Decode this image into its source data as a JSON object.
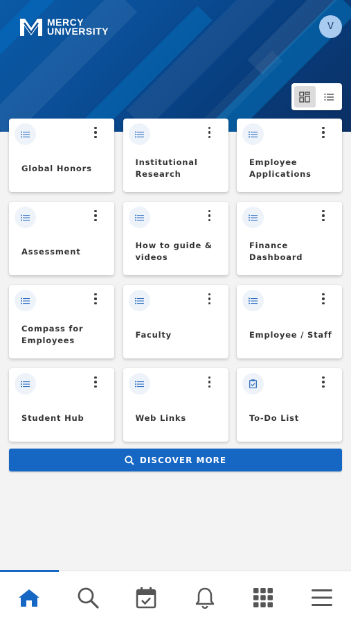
{
  "brand": {
    "line1": "MERCY",
    "line2": "UNIVERSITY"
  },
  "user": {
    "avatar_initial": "V"
  },
  "view_toggle": {
    "active": "grid",
    "options": [
      "grid-view-icon",
      "list-view-icon"
    ]
  },
  "tiles": [
    {
      "label": "Global Honors",
      "icon": "list-icon"
    },
    {
      "label": "Institutional Research",
      "icon": "list-icon"
    },
    {
      "label": "Employee Applications",
      "icon": "list-icon"
    },
    {
      "label": "Assessment",
      "icon": "list-icon"
    },
    {
      "label": "How to guide & videos",
      "icon": "list-icon"
    },
    {
      "label": "Finance Dashboard",
      "icon": "list-icon"
    },
    {
      "label": "Compass for Employees",
      "icon": "list-icon"
    },
    {
      "label": "Faculty",
      "icon": "list-icon"
    },
    {
      "label": "Employee / Staff",
      "icon": "list-icon"
    },
    {
      "label": "Student Hub",
      "icon": "list-icon"
    },
    {
      "label": "Web Links",
      "icon": "list-icon"
    },
    {
      "label": "To-Do List",
      "icon": "clipboard-check-icon"
    }
  ],
  "discover_button": {
    "label": "DISCOVER MORE",
    "icon": "search-icon"
  },
  "bottom_nav": {
    "active": "home",
    "items": [
      "home-icon",
      "search-icon",
      "calendar-check-icon",
      "bell-icon",
      "apps-grid-icon",
      "menu-icon"
    ]
  },
  "colors": {
    "accent": "#1667c4",
    "header_dark": "#0b2f63",
    "header_light": "#0a5aa6",
    "icon_tint": "#2f6fc0",
    "icon_bg": "#eef3fa"
  }
}
